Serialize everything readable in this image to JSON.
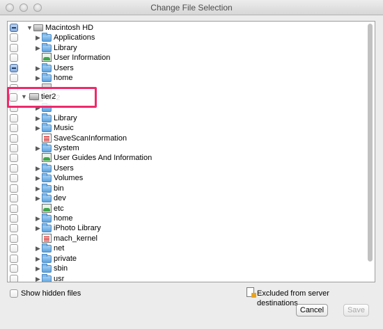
{
  "window": {
    "title": "Change File Selection"
  },
  "tree": [
    {
      "label": "Macintosh HD",
      "state": "mixed",
      "indent": 0,
      "expander": "expanded",
      "icon": "drive-icon"
    },
    {
      "label": "Applications",
      "state": "unchecked",
      "indent": 1,
      "expander": "collapsed",
      "icon": "folder-icon"
    },
    {
      "label": "Library",
      "state": "unchecked",
      "indent": 1,
      "expander": "collapsed",
      "icon": "folder-icon"
    },
    {
      "label": "User Information",
      "state": "unchecked",
      "indent": 1,
      "expander": "none",
      "icon": "green-doc-icon"
    },
    {
      "label": "Users",
      "state": "mixed",
      "indent": 1,
      "expander": "collapsed",
      "icon": "folder-icon"
    },
    {
      "label": "home",
      "state": "unchecked",
      "indent": 1,
      "expander": "collapsed",
      "icon": "folder-icon"
    },
    {
      "label": "",
      "state": "unchecked",
      "indent": 1,
      "expander": "none",
      "icon": "gray-icon"
    },
    {
      "label": "tier2",
      "state": "unchecked",
      "indent": 0,
      "expander": "expanded",
      "icon": "drive-icon"
    },
    {
      "label": "",
      "state": "unchecked",
      "indent": 1,
      "expander": "collapsed",
      "icon": "folder-icon"
    },
    {
      "label": "Library",
      "state": "unchecked",
      "indent": 1,
      "expander": "collapsed",
      "icon": "folder-icon"
    },
    {
      "label": "Music",
      "state": "unchecked",
      "indent": 1,
      "expander": "collapsed",
      "icon": "folder-icon"
    },
    {
      "label": "SaveScanInformation",
      "state": "unchecked",
      "indent": 1,
      "expander": "none",
      "icon": "doc-icon"
    },
    {
      "label": "System",
      "state": "unchecked",
      "indent": 1,
      "expander": "collapsed",
      "icon": "folder-icon"
    },
    {
      "label": "User Guides And Information",
      "state": "unchecked",
      "indent": 1,
      "expander": "none",
      "icon": "green-doc-icon"
    },
    {
      "label": "Users",
      "state": "unchecked",
      "indent": 1,
      "expander": "collapsed",
      "icon": "folder-icon"
    },
    {
      "label": "Volumes",
      "state": "unchecked",
      "indent": 1,
      "expander": "collapsed",
      "icon": "folder-icon"
    },
    {
      "label": "bin",
      "state": "unchecked",
      "indent": 1,
      "expander": "collapsed",
      "icon": "folder-icon"
    },
    {
      "label": "dev",
      "state": "unchecked",
      "indent": 1,
      "expander": "collapsed",
      "icon": "folder-icon"
    },
    {
      "label": "etc",
      "state": "unchecked",
      "indent": 1,
      "expander": "none",
      "icon": "green-doc-icon"
    },
    {
      "label": "home",
      "state": "unchecked",
      "indent": 1,
      "expander": "collapsed",
      "icon": "folder-icon"
    },
    {
      "label": "iPhoto Library",
      "state": "unchecked",
      "indent": 1,
      "expander": "collapsed",
      "icon": "folder-icon"
    },
    {
      "label": "mach_kernel",
      "state": "unchecked",
      "indent": 1,
      "expander": "none",
      "icon": "doc-icon"
    },
    {
      "label": "net",
      "state": "unchecked",
      "indent": 1,
      "expander": "collapsed",
      "icon": "folder-icon"
    },
    {
      "label": "private",
      "state": "unchecked",
      "indent": 1,
      "expander": "collapsed",
      "icon": "folder-icon"
    },
    {
      "label": "sbin",
      "state": "unchecked",
      "indent": 1,
      "expander": "collapsed",
      "icon": "folder-icon"
    },
    {
      "label": "usr",
      "state": "unchecked",
      "indent": 1,
      "expander": "collapsed",
      "icon": "folder-icon"
    }
  ],
  "highlight": {
    "label": "tier2",
    "color": "#ee2a6b"
  },
  "footer": {
    "show_hidden_label": "Show hidden files",
    "excluded_label": "Excluded from server destinations",
    "cancel_label": "Cancel",
    "save_label": "Save"
  }
}
